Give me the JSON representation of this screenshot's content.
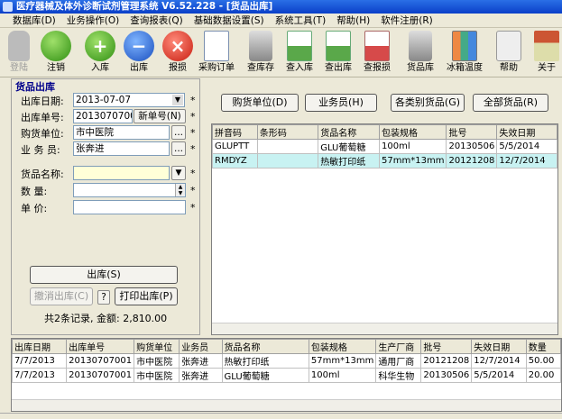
{
  "window": {
    "title": "医疗器械及体外诊断试剂管理系统 V6.52.228 - [货品出库]"
  },
  "menu": [
    "数据库(D)",
    "业务操作(O)",
    "查询报表(Q)",
    "基础数据设置(S)",
    "系统工具(T)",
    "帮助(H)",
    "软件注册(R)"
  ],
  "toolbar": [
    {
      "label": "登陆",
      "icon": "person-icon",
      "disabled": true
    },
    {
      "label": "注销",
      "icon": "runner-icon"
    },
    {
      "label": "入库",
      "icon": "plus-icon"
    },
    {
      "label": "出库",
      "icon": "minus-icon"
    },
    {
      "label": "报损",
      "icon": "cross-icon"
    },
    {
      "label": "采购订单",
      "icon": "document-icon"
    },
    {
      "label": "查库存",
      "icon": "disk-search-icon"
    },
    {
      "label": "查入库",
      "icon": "sheet-search-icon"
    },
    {
      "label": "查出库",
      "icon": "sheet-search-icon"
    },
    {
      "label": "查报损",
      "icon": "sheet-search-red-icon"
    },
    {
      "label": "货品库",
      "icon": "database-icon"
    },
    {
      "label": "冰箱温度",
      "icon": "chart-icon"
    },
    {
      "label": "帮助",
      "icon": "help-icon"
    },
    {
      "label": "关于",
      "icon": "house-icon"
    }
  ],
  "form": {
    "section_title": "货品出库",
    "date_label": "出库日期:",
    "date_value": "2013-07-07",
    "number_label": "出库单号:",
    "number_value": "20130707001",
    "new_number_button": "新单号(N)",
    "buyer_label": "购货单位:",
    "buyer_value": "市中医院",
    "salesman_label": "业 务 员:",
    "salesman_value": "张奔进",
    "goods_label": "货品名称:",
    "goods_value": "",
    "qty_label": "数    量:",
    "qty_value": "",
    "price_label": "单    价:",
    "price_value": "",
    "star": "*",
    "dots": "...",
    "outbound_button": "出库(S)",
    "cancel_button": "撤消出库(C)",
    "help_button": "?",
    "print_button": "打印出库(P)",
    "summary": "共2条记录, 金额: 2,810.00"
  },
  "filters": [
    "购货单位(D)",
    "业务员(H)",
    "各类别货品(G)",
    "全部货品(R)"
  ],
  "goods_table": {
    "columns": [
      "拼音码",
      "条形码",
      "货品名称",
      "包装规格",
      "批号",
      "失效日期"
    ],
    "rows": [
      [
        "GLUPTT",
        "",
        "GLU葡萄糖",
        "100ml",
        "20130506",
        "5/5/2014"
      ],
      [
        "RMDYZ",
        "",
        "热敏打印纸",
        "57mm*13mm",
        "20121208",
        "12/7/2014"
      ]
    ],
    "selected_row": 1
  },
  "records_table": {
    "columns": [
      "出库日期",
      "出库单号",
      "购货单位",
      "业务员",
      "货品名称",
      "包装规格",
      "生产厂商",
      "批号",
      "失效日期",
      "数量"
    ],
    "rows": [
      [
        "7/7/2013",
        "20130707001",
        "市中医院",
        "张奔进",
        "热敏打印纸",
        "57mm*13mm",
        "通用厂商",
        "20121208",
        "12/7/2014",
        "50.00"
      ],
      [
        "7/7/2013",
        "20130707001",
        "市中医院",
        "张奔进",
        "GLU葡萄糖",
        "100ml",
        "科华生物",
        "20130506",
        "5/5/2014",
        "20.00"
      ]
    ]
  }
}
